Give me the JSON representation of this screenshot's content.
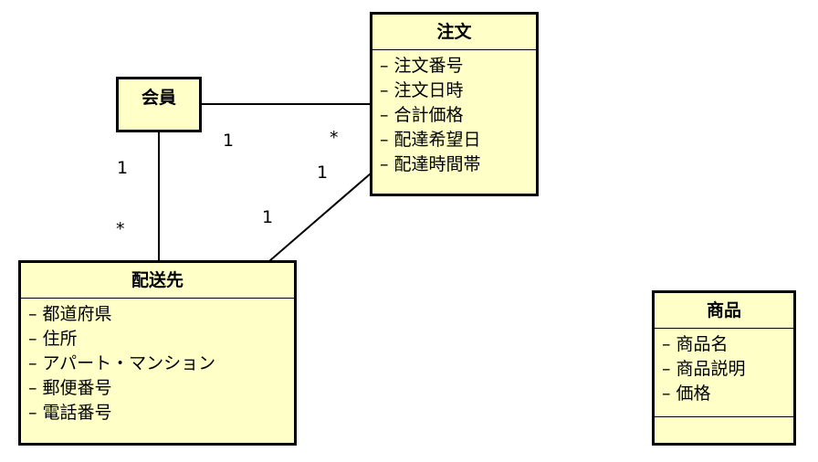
{
  "classes": {
    "order": {
      "name": "注文",
      "attributes": [
        "– 注文番号",
        "– 注文日時",
        "– 合計価格",
        "– 配達希望日",
        "– 配達時間帯"
      ]
    },
    "member": {
      "name": "会員"
    },
    "delivery": {
      "name": "配送先",
      "attributes": [
        "– 都道府県",
        "– 住所",
        "– アパート・マンション",
        "– 郵便番号",
        "– 電話番号"
      ]
    },
    "product": {
      "name": "商品",
      "attributes": [
        "– 商品名",
        "– 商品説明",
        "– 価格"
      ]
    }
  },
  "multiplicities": {
    "member_order_member_end": "1",
    "member_order_order_end": "*",
    "member_delivery_member_end": "1",
    "member_delivery_delivery_end": "*",
    "order_delivery_order_end": "1",
    "order_delivery_delivery_end": "1"
  }
}
